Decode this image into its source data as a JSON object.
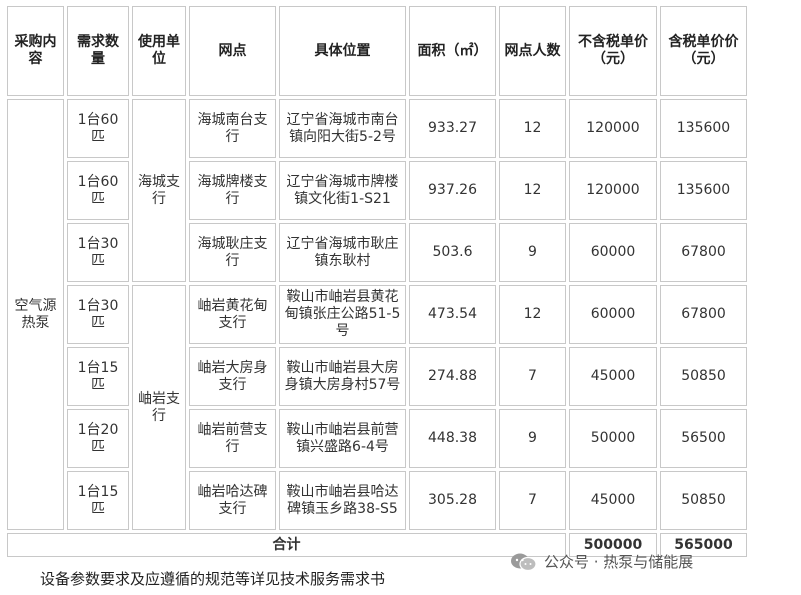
{
  "headers": [
    "采购内容",
    "需求数量",
    "使用单位",
    "网点",
    "具体位置",
    "面积（㎡）",
    "网点人数",
    "不含税单价（元）",
    "含税单价价（元）"
  ],
  "content_item": "空气源热泵",
  "units": [
    "海城支行",
    "岫岩支行"
  ],
  "rows": [
    {
      "qty": "1台60匹",
      "branch": "海城南台支行",
      "location": "辽宁省海城市南台镇向阳大街5-2号",
      "area": "933.27",
      "staff": "12",
      "price_ex": "120000",
      "price_inc": "135600"
    },
    {
      "qty": "1台60匹",
      "branch": "海城牌楼支行",
      "location": "辽宁省海城市牌楼镇文化街1-S21",
      "area": "937.26",
      "staff": "12",
      "price_ex": "120000",
      "price_inc": "135600"
    },
    {
      "qty": "1台30匹",
      "branch": "海城耿庄支行",
      "location": "辽宁省海城市耿庄镇东耿村",
      "area": "503.6",
      "staff": "9",
      "price_ex": "60000",
      "price_inc": "67800"
    },
    {
      "qty": "1台30匹",
      "branch": "岫岩黄花甸支行",
      "location": "鞍山市岫岩县黄花甸镇张庄公路51-5号",
      "area": "473.54",
      "staff": "12",
      "price_ex": "60000",
      "price_inc": "67800"
    },
    {
      "qty": "1台15匹",
      "branch": "岫岩大房身支行",
      "location": "鞍山市岫岩县大房身镇大房身村57号",
      "area": "274.88",
      "staff": "7",
      "price_ex": "45000",
      "price_inc": "50850"
    },
    {
      "qty": "1台20匹",
      "branch": "岫岩前营支行",
      "location": "鞍山市岫岩县前营镇兴盛路6-4号",
      "area": "448.38",
      "staff": "9",
      "price_ex": "50000",
      "price_inc": "56500"
    },
    {
      "qty": "1台15匹",
      "branch": "岫岩哈达碑支行",
      "location": "鞍山市岫岩县哈达碑镇玉乡路38-S5",
      "area": "305.28",
      "staff": "7",
      "price_ex": "45000",
      "price_inc": "50850"
    }
  ],
  "total": {
    "label": "合计",
    "price_ex": "500000",
    "price_inc": "565000"
  },
  "footer_note": "设备参数要求及应遵循的规范等详见技术服务需求书",
  "watermark": {
    "text": "公众号 · 热泵与储能展",
    "icon": "wechat-icon"
  }
}
